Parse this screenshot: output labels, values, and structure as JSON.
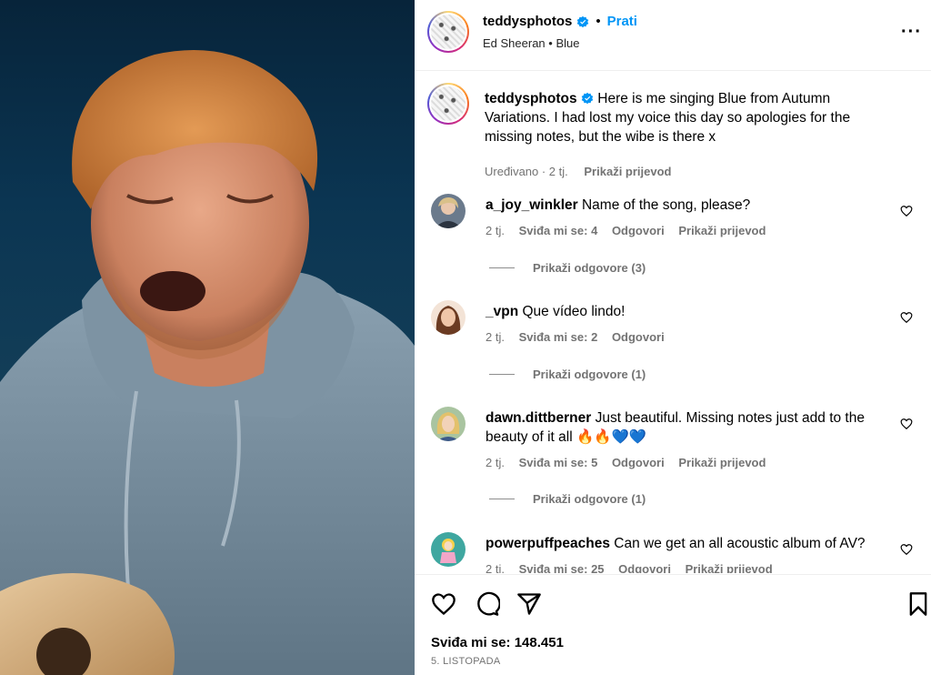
{
  "header": {
    "username": "teddysphotos",
    "follow_label": "Prati",
    "subtitle_artist": "Ed Sheeran",
    "subtitle_song": "Blue",
    "more_icon": "more-options-icon"
  },
  "caption": {
    "username": "teddysphotos",
    "text": "Here is me singing Blue from Autumn Variations. I had lost my voice this day so apologies for the missing notes, but the wibe is there x",
    "edited_time": "Uređivano · 2 tj.",
    "translate_label": "Prikaži prijevod"
  },
  "comments": [
    {
      "username": "a_joy_winkler",
      "text": "Name of the song, please?",
      "time": "2 tj.",
      "likes": "Sviđa mi se: 4",
      "reply_label": "Odgovori",
      "translate_label": "Prikaži prijevod",
      "replies_label": "Prikaži odgovore (3)"
    },
    {
      "username": "_vpn",
      "text": "Que vídeo lindo!",
      "time": "2 tj.",
      "likes": "Sviđa mi se: 2",
      "reply_label": "Odgovori",
      "replies_label": "Prikaži odgovore (1)"
    },
    {
      "username": "dawn.dittberner",
      "text": "Just beautiful. Missing notes just add to the beauty of it all",
      "emoji": "🔥🔥💙💙",
      "time": "2 tj.",
      "likes": "Sviđa mi se: 5",
      "reply_label": "Odgovori",
      "translate_label": "Prikaži prijevod",
      "replies_label": "Prikaži odgovore (1)"
    },
    {
      "username": "powerpuffpeaches",
      "text": "Can we get an all acoustic album of AV?",
      "time": "2 tj.",
      "likes": "Sviđa mi se: 25",
      "reply_label": "Odgovori",
      "translate_label": "Prikaži prijevod"
    }
  ],
  "footer": {
    "likes_label": "Sviđa mi se: 148.451",
    "date": "5. LISTOPADA"
  },
  "colors": {
    "accent": "#0095f6",
    "secondary_text": "#737373",
    "verified": "#0095f6"
  }
}
